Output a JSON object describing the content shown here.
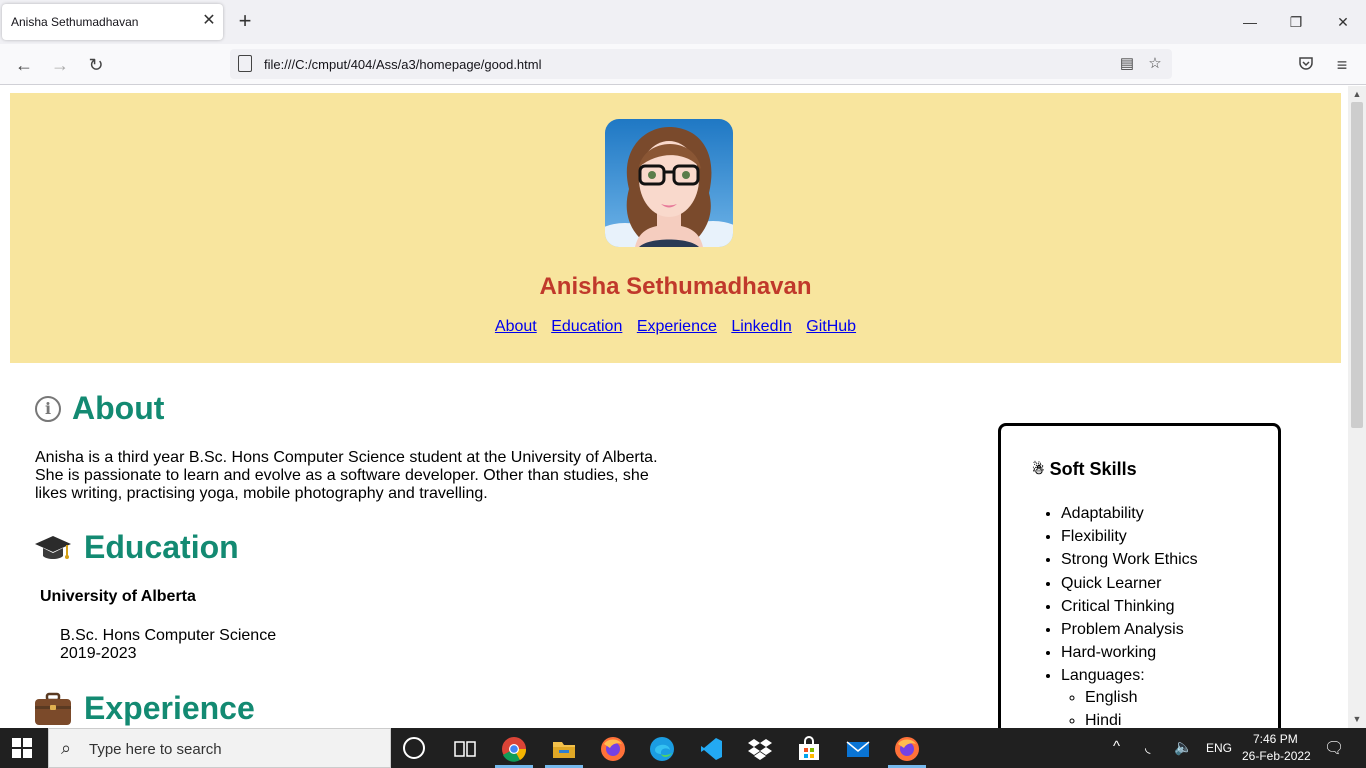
{
  "browser": {
    "tab_title": "Anisha Sethumadhavan",
    "url": "file:///C:/cmput/404/Ass/a3/homepage/good.html"
  },
  "header": {
    "name": "Anisha Sethumadhavan",
    "nav": [
      "About",
      "Education",
      "Experience",
      "LinkedIn",
      "GitHub"
    ]
  },
  "about": {
    "heading": "About",
    "lines": [
      "Anisha is a third year B.Sc. Hons Computer Science student at the University of Alberta.",
      "She is passionate to learn and evolve as a software developer. Other than studies, she",
      "likes writing, practising yoga, mobile photography and travelling."
    ]
  },
  "education": {
    "heading": "Education",
    "university": "University of Alberta",
    "degree": "B.Sc. Hons Computer Science",
    "years": "2019-2023"
  },
  "experience": {
    "heading": "Experience"
  },
  "soft_skills": {
    "icon": "☃",
    "title": "Soft Skills",
    "items": [
      "Adaptability",
      "Flexibility",
      "Strong Work Ethics",
      "Quick Learner",
      "Critical Thinking",
      "Problem Analysis",
      "Hard-working",
      "Languages:"
    ],
    "languages": [
      "English",
      "Hindi"
    ]
  },
  "taskbar": {
    "search_placeholder": "Type here to search",
    "language": "ENG",
    "time": "7:46 PM",
    "date": "26-Feb-2022"
  },
  "colors": {
    "header_bg": "#f8e59e",
    "name_color": "#c0392b",
    "heading_color": "#138a72",
    "link_color": "#0000ee"
  }
}
